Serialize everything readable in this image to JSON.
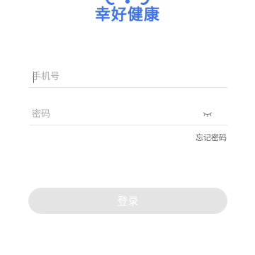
{
  "app": {
    "name": "幸好健康",
    "brand_color": "#3f73f0"
  },
  "login_form": {
    "phone_placeholder": "手机号",
    "phone_value": "",
    "password_placeholder": "密码",
    "password_value": "",
    "password_toggle_icon": "eye-closed-icon",
    "forgot_password_label": "忘记密码",
    "login_button_label": "登录",
    "login_button_color": "#e4e4e4"
  }
}
